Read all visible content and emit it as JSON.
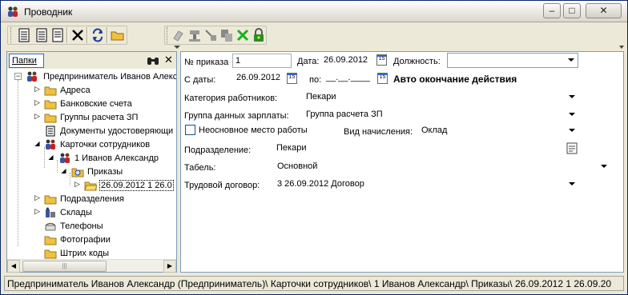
{
  "window": {
    "title": "Проводник",
    "minimize": "–",
    "maximize": "□",
    "close": "✕"
  },
  "toolbar": {
    "buttons": [
      "document-icon",
      "document-icon",
      "document-icon",
      "delete-icon",
      "refresh-icon",
      "folder-open-icon",
      "eraser-icon",
      "stamp-icon",
      "copy-icon",
      "paste-icon",
      "cancel-icon",
      "lock-icon"
    ]
  },
  "left": {
    "tab": "Папки",
    "tree": [
      {
        "label": "Предприниматель Иванов Алекс",
        "icon": "people-icon"
      },
      {
        "label": "Адреса",
        "icon": "folder-icon"
      },
      {
        "label": "Банковские счета",
        "icon": "folder-icon"
      },
      {
        "label": "Группы расчета ЗП",
        "icon": "folder-icon"
      },
      {
        "label": "Документы удостоверяющи",
        "icon": "document-icon"
      },
      {
        "label": "Карточки сотрудников",
        "icon": "people-icon"
      },
      {
        "label": "1 Иванов Александр",
        "icon": "people-icon"
      },
      {
        "label": "Приказы",
        "icon": "folder-search-icon"
      },
      {
        "label": "26.09.2012  1 26.0",
        "icon": "folder-open-icon"
      },
      {
        "label": "Подразделения",
        "icon": "folder-icon"
      },
      {
        "label": "Склады",
        "icon": "warehouse-icon"
      },
      {
        "label": "Телефоны",
        "icon": "phone-icon"
      },
      {
        "label": "Фотографии",
        "icon": "folder-icon"
      },
      {
        "label": "Штрих коды",
        "icon": "folder-icon"
      }
    ]
  },
  "form": {
    "order_no_label": "№ приказа",
    "order_no": "1",
    "date_label": "Дата:",
    "date": "26.09.2012",
    "position_label": "Должность:",
    "position": "",
    "from_label": "С даты:",
    "from_date": "26.09.2012",
    "to_label": "по:",
    "to_date": "__.__.____",
    "auto_end": "Авто окончание действия",
    "category_label": "Категория работников:",
    "category": "Пекари",
    "salary_group_label": "Группа данных зарплаты:",
    "salary_group": "Группа расчета ЗП",
    "secondary_label": "Неосновное место работы",
    "accrual_label": "Вид начисления:",
    "accrual": "Оклад",
    "department_label": "Подразделение:",
    "department": "Пекари",
    "tabel_label": "Табель:",
    "tabel": "Основной",
    "contract_label": "Трудовой договор:",
    "contract": "3 26.09.2012 Договор",
    "calendar_glyph": "15"
  },
  "status": "Предприниматель Иванов Александр (Предприниматель)\\ Карточки сотрудников\\ 1 Иванов Александр\\ Приказы\\ 26.09.2012  1 26.09.20"
}
